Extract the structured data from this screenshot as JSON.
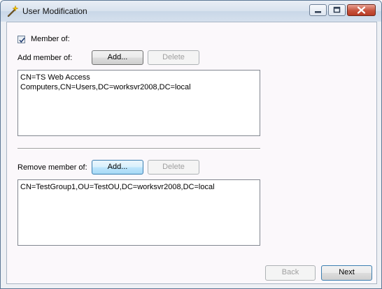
{
  "window": {
    "title": "User Modification",
    "icon": "magic-wand-icon",
    "caption_icons": [
      "minimize-icon",
      "maximize-icon",
      "close-icon"
    ]
  },
  "member_of": {
    "checkbox_label": "Member of:",
    "checked": true
  },
  "add_section": {
    "label": "Add member of:",
    "add_button": "Add...",
    "delete_button": "Delete",
    "items": [
      "CN=TS Web Access Computers,CN=Users,DC=worksvr2008,DC=local"
    ]
  },
  "remove_section": {
    "label": "Remove member of:",
    "add_button": "Add...",
    "delete_button": "Delete",
    "items": [
      "CN=TestGroup1,OU=TestOU,DC=worksvr2008,DC=local"
    ]
  },
  "footer": {
    "back_button": "Back",
    "next_button": "Next"
  },
  "colors": {
    "close_button": "#c6533d",
    "focus_border": "#3c7fb1"
  }
}
